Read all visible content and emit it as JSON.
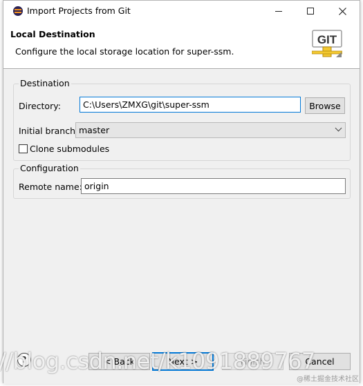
{
  "window": {
    "title": "Import Projects from Git"
  },
  "header": {
    "title": "Local Destination",
    "description": "Configure the local storage location for super-ssm.",
    "logo_text": "GIT"
  },
  "destination": {
    "group_label": "Destination",
    "directory_label": "Directory:",
    "directory_value": "C:\\Users\\ZMXG\\git\\super-ssm",
    "browse_label": "Browse",
    "initial_branch_label": "Initial branch:",
    "initial_branch_value": "master",
    "clone_submodules_label": "Clone submodules",
    "clone_submodules_checked": false
  },
  "configuration": {
    "group_label": "Configuration",
    "remote_name_label": "Remote name:",
    "remote_name_value": "origin"
  },
  "footer": {
    "back_label": "< Back",
    "next_label": "Next >",
    "finish_label": "Finish",
    "cancel_label": "Cancel"
  },
  "watermark": {
    "url_text": "//blog.csdn.net/k1091889767",
    "site_text": "@稀土掘金技术社区"
  },
  "colors": {
    "focus_border": "#0078d7",
    "dialog_bg": "#f0f0f0"
  }
}
